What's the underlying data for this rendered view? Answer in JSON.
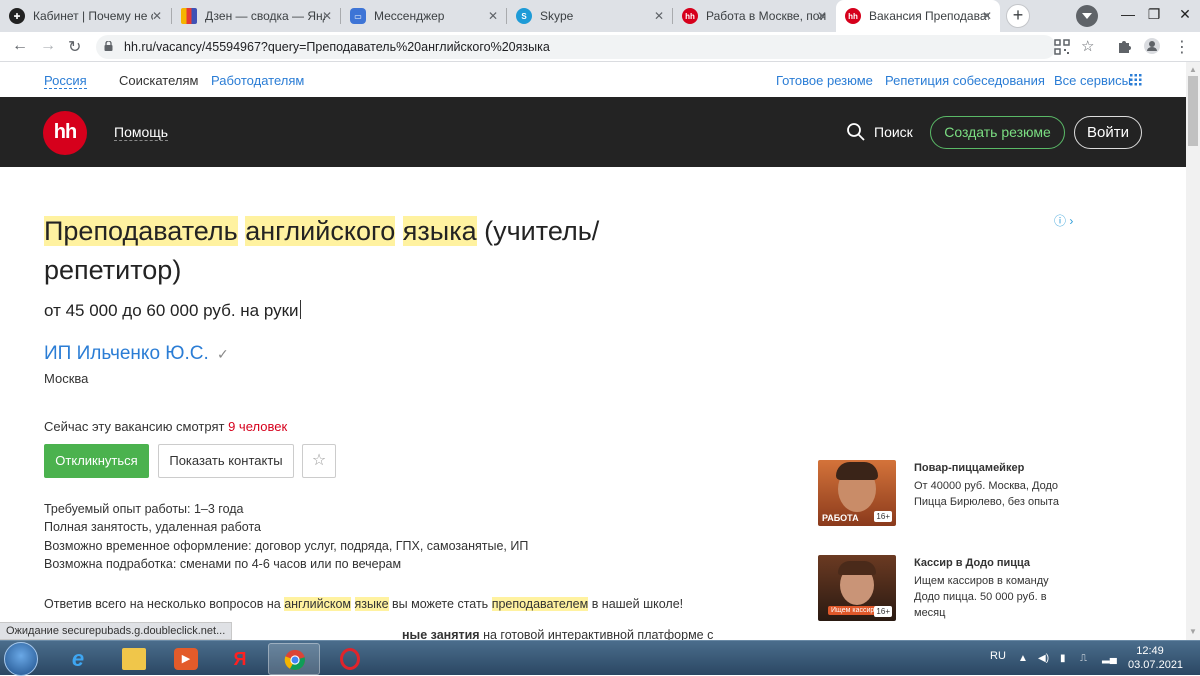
{
  "browser": {
    "tabs": [
      {
        "title": "Кабинет | Почему не с",
        "favicon": "dzen-circle-icon",
        "active": false
      },
      {
        "title": "Дзен — сводка — Янд",
        "favicon": "bar-chart-icon",
        "active": false
      },
      {
        "title": "Мессенджер",
        "favicon": "messenger-icon",
        "active": false
      },
      {
        "title": "Skype",
        "favicon": "skype-icon",
        "active": false
      },
      {
        "title": "Работа в Москве, пои",
        "favicon": "hh-icon",
        "active": false
      },
      {
        "title": "Вакансия Преподавате",
        "favicon": "hh-icon",
        "active": true
      }
    ],
    "url": "hh.ru/vacancy/45594967?query=Преподаватель%20английского%20языка",
    "status_text": "Ожидание securepubads.g.doubleclick.net..."
  },
  "topnav": {
    "region": "Россия",
    "seekers": "Соискателям",
    "employers": "Работодателям",
    "ready_resume": "Готовое резюме",
    "interview": "Репетиция собеседования",
    "all_services": "Все сервисы"
  },
  "header": {
    "logo": "hh",
    "help": "Помощь",
    "search": "Поиск",
    "create_resume": "Создать резюме",
    "login": "Войти"
  },
  "vacancy": {
    "title_parts": [
      "Преподаватель",
      "английского",
      "языка",
      "(учитель/",
      "репетитор)"
    ],
    "salary": "от 45 000 до 60 000 руб. на руки",
    "company": "ИП Ильченко Ю.С.",
    "city": "Москва",
    "viewing_prefix": "Сейчас эту вакансию смотрят",
    "viewing_count": "9 человек",
    "respond": "Откликнуться",
    "show_contacts": "Показать контакты",
    "requirements": [
      "Требуемый опыт работы: 1–3 года",
      "Полная занятость, удаленная работа",
      "Возможно временное оформление: договор услуг, подряда, ГПХ, самозанятые, ИП",
      "Возможна подработка: сменами по 4-6 часов или по вечерам"
    ],
    "desc_line1": {
      "a": "Ответив всего на несколько вопросов на",
      "hl1": "английском",
      "sp": " ",
      "hl2": "языке",
      "b": "вы можете стать",
      "hl3": "преподавателем",
      "c": "в нашей школе!"
    },
    "desc_line2": {
      "bold": "ные занятия",
      "rest": "на готовой интерактивной платформе с"
    }
  },
  "ads": [
    {
      "title": "Повар-пиццамейкер",
      "text": "От 40000 руб. Москва, Додо Пицца Бирюлево, без опыта",
      "tag": "РАБОТА",
      "badge": "16+"
    },
    {
      "title": "Кассир в Додо пицца",
      "text": "Ищем кассиров в команду Додо пицца. 50 000 руб. в месяц",
      "tag": "Ищем кассиров",
      "badge": "16+"
    }
  ],
  "taskbar": {
    "lang": "RU",
    "time": "12:49",
    "date": "03.07.2021"
  },
  "colors": {
    "accent_link": "#2b7dd5",
    "header_bg": "#232323",
    "hh_red": "#d6001c",
    "respond_green": "#4bb24e",
    "highlight": "#fff2a0"
  }
}
